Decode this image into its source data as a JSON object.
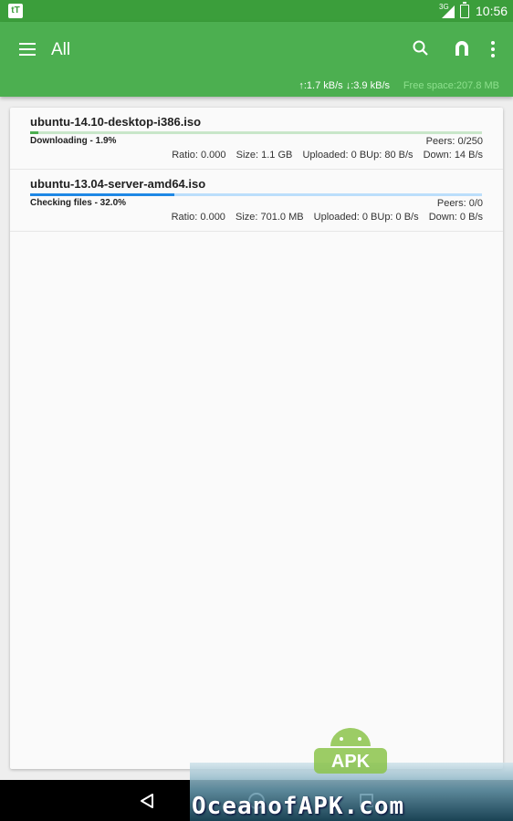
{
  "status_bar": {
    "network": "3G",
    "time": "10:56"
  },
  "app_bar": {
    "title": "All",
    "upload_speed": "↑:1.7 kB/s",
    "download_speed": "↓:3.9 kB/s",
    "free_space": "Free space:207.8 MB",
    "accent": "#4caf50"
  },
  "torrents": [
    {
      "name": "ubuntu-14.10-desktop-i386.iso",
      "status": "Downloading - 1.9%",
      "progress": 0.019,
      "progress_color": "#4caf50",
      "track_color": "#c8e6c9",
      "peers": "Peers: 0/250",
      "ratio": "Ratio: 0.000",
      "size": "Size: 1.1 GB",
      "uploaded": "Uploaded: 0 B",
      "up": "Up: 80 B/s",
      "down": "Down: 14 B/s"
    },
    {
      "name": "ubuntu-13.04-server-amd64.iso",
      "status": "Checking files - 32.0%",
      "progress": 0.32,
      "progress_color": "#1e88e5",
      "track_color": "#bbdefb",
      "peers": "Peers: 0/0",
      "ratio": "Ratio: 0.000",
      "size": "Size: 701.0 MB",
      "uploaded": "Uploaded: 0 B",
      "up": "Up: 0 B/s",
      "down": "Down: 0 B/s"
    }
  ],
  "watermark": {
    "badge": "APK",
    "text": "OceanofAPK.com"
  }
}
